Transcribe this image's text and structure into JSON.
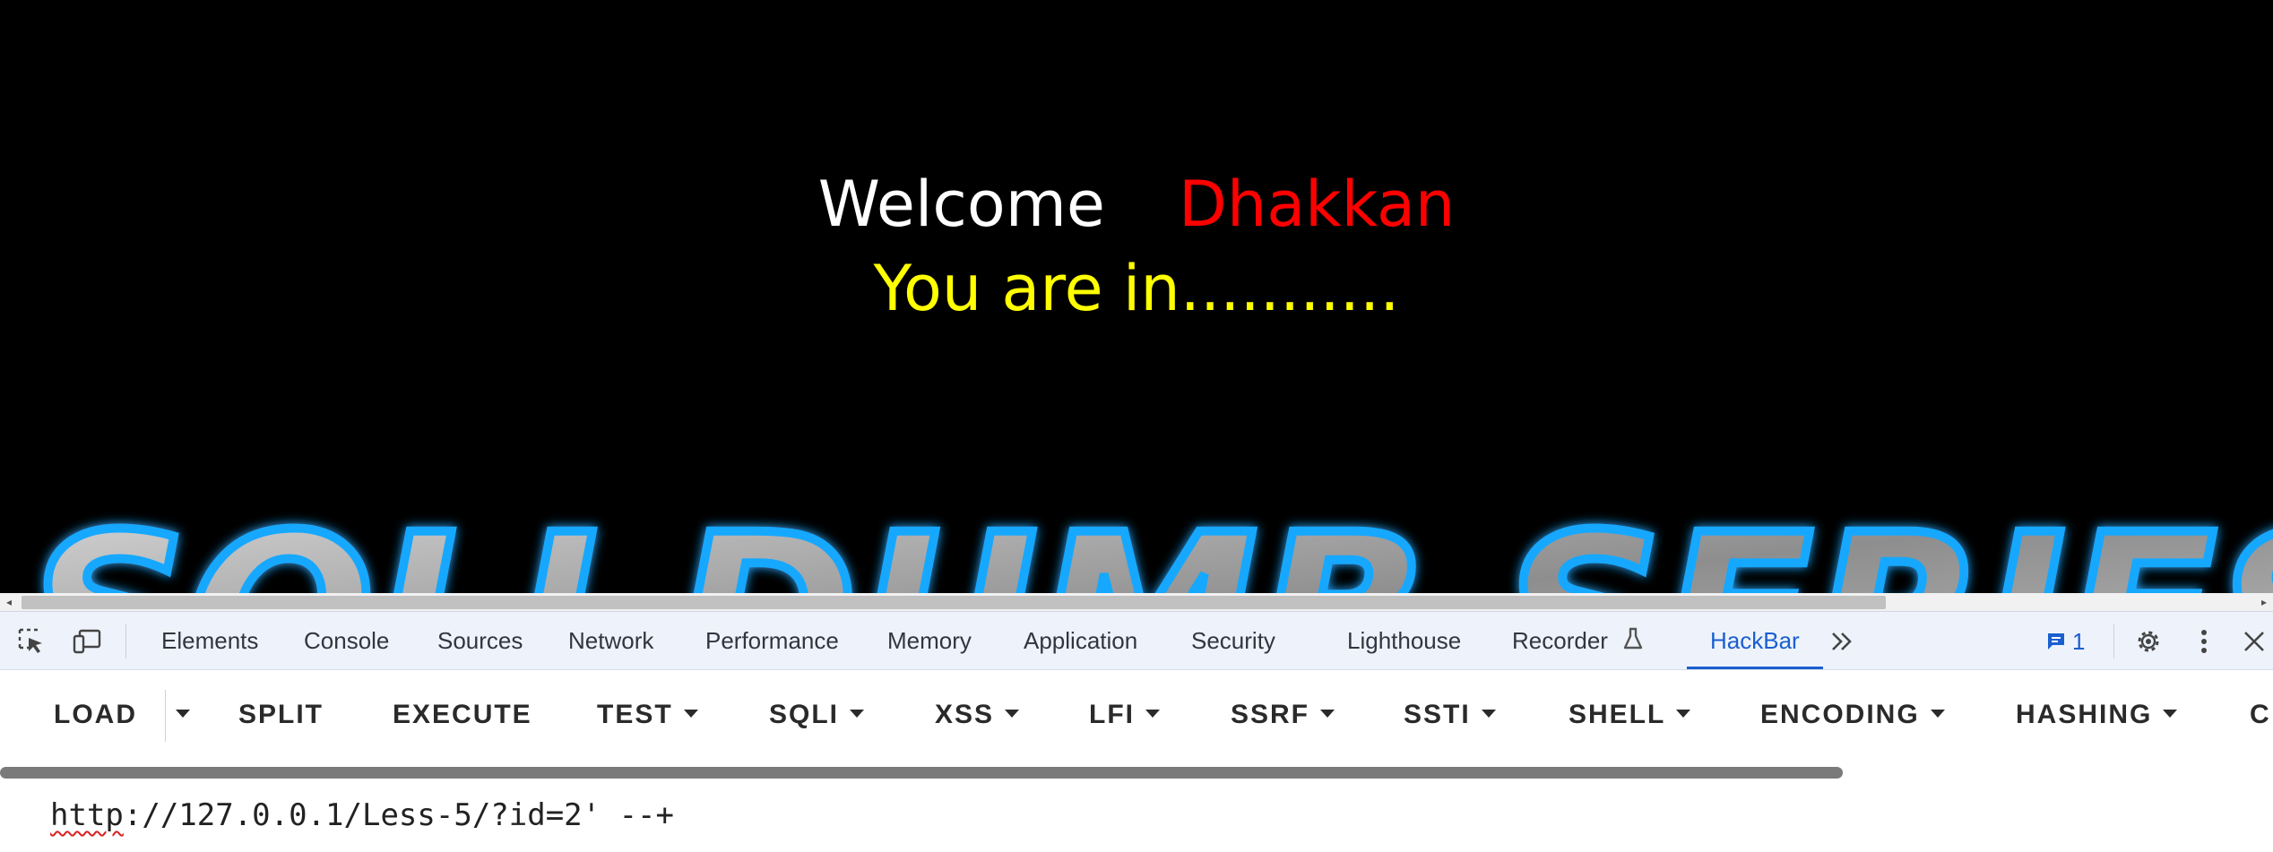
{
  "page": {
    "welcome_word": "Welcome",
    "name_word": "Dhakkan",
    "status_text": "You are in...........",
    "banner_text": "SQLI DUMB SERIES",
    "colors": {
      "background": "#000000",
      "welcome": "#ffffff",
      "name": "#ff0000",
      "status": "#ffff00",
      "banner_glow": "#1aa3ff"
    }
  },
  "devtools": {
    "tabs": [
      {
        "label": "Elements"
      },
      {
        "label": "Console"
      },
      {
        "label": "Sources"
      },
      {
        "label": "Network"
      },
      {
        "label": "Performance"
      },
      {
        "label": "Memory"
      },
      {
        "label": "Application"
      },
      {
        "label": "Security"
      },
      {
        "label": "Lighthouse"
      },
      {
        "label": "Recorder"
      },
      {
        "label": "HackBar",
        "active": true
      }
    ],
    "issues_count": "1",
    "icons": [
      "inspect-element-icon",
      "device-toolbar-icon",
      "flask-icon",
      "more-tabs-icon",
      "issues-icon",
      "settings-icon",
      "kebab-menu-icon",
      "close-icon"
    ]
  },
  "hackbar": {
    "buttons": [
      {
        "label": "LOAD"
      },
      {
        "label": "SPLIT"
      },
      {
        "label": "EXECUTE"
      },
      {
        "label": "TEST"
      },
      {
        "label": "SQLI"
      },
      {
        "label": "XSS"
      },
      {
        "label": "LFI"
      },
      {
        "label": "SSRF"
      },
      {
        "label": "SSTI"
      },
      {
        "label": "SHELL"
      },
      {
        "label": "ENCODING"
      },
      {
        "label": "HASHING"
      },
      {
        "label": "C"
      }
    ],
    "url_scheme": "http",
    "url_rest": "://127.0.0.1/Less-5/?id=2' --+"
  }
}
